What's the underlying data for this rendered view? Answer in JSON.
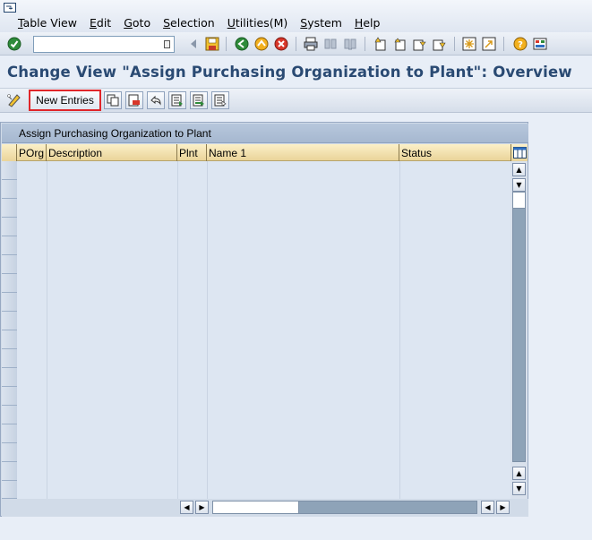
{
  "menu": {
    "items": [
      "Table View",
      "Edit",
      "Goto",
      "Selection",
      "Utilities(M)",
      "System",
      "Help"
    ]
  },
  "toolbar": {
    "command_value": ""
  },
  "page": {
    "title": "Change View \"Assign Purchasing Organization to Plant\": Overview"
  },
  "app_toolbar": {
    "new_entries_label": "New Entries"
  },
  "table": {
    "title": "Assign Purchasing Organization to Plant",
    "columns": [
      "POrg",
      "Description",
      "Plnt",
      "Name 1",
      "Status"
    ],
    "rows": []
  },
  "colors": {
    "title_text": "#2a4a73",
    "highlight_border": "#e0262a",
    "column_header": "#ead49a"
  }
}
